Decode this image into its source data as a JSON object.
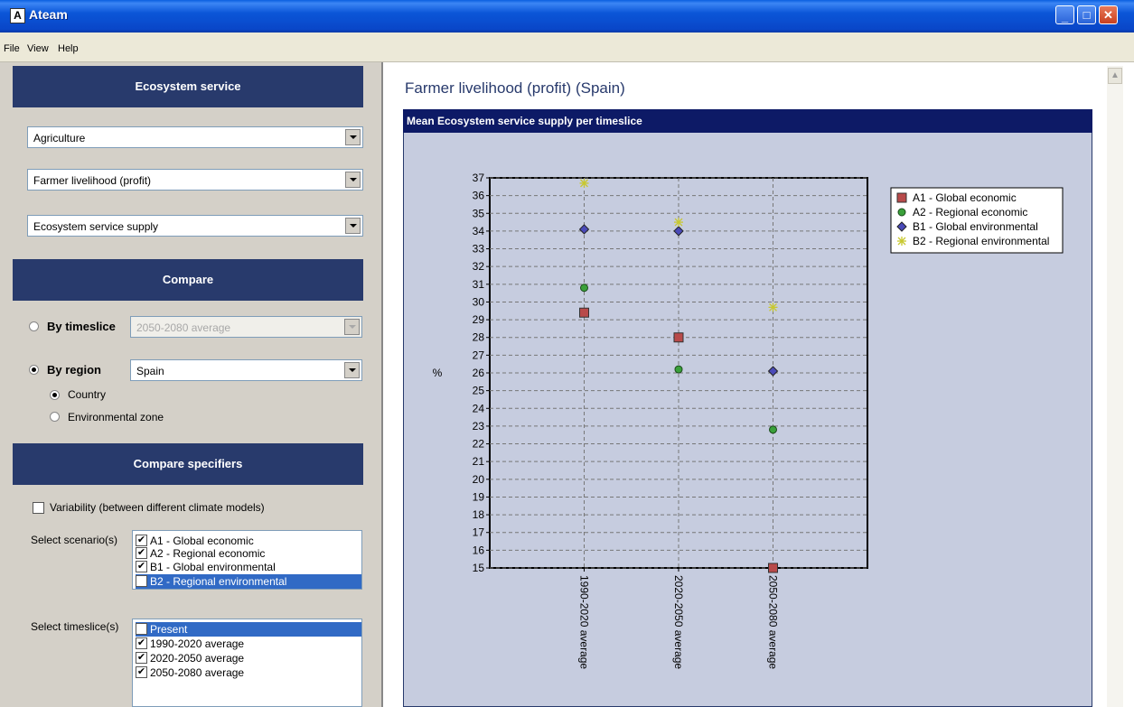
{
  "window": {
    "title": "Ateam",
    "icon_letter": "A"
  },
  "menu": [
    "File",
    "View",
    "Help"
  ],
  "ecosystem_service": {
    "header": "Ecosystem service",
    "sector": "Agriculture",
    "service": "Farmer livelihood (profit)",
    "indicator": "Ecosystem service supply"
  },
  "compare": {
    "header": "Compare",
    "by_timeslice_label": "By timeslice",
    "timeslice_value": "2050-2080 average",
    "by_region_label": "By region",
    "region_value": "Spain",
    "country_label": "Country",
    "env_zone_label": "Environmental zone",
    "selected_mode": "By region",
    "selected_region_type": "Country"
  },
  "compare_specifiers": {
    "header": "Compare specifiers",
    "variability_label": "Variability (between different climate models)",
    "variability_checked": false,
    "scenarios_label": "Select scenario(s)",
    "scenarios": [
      {
        "label": "A1 - Global economic",
        "checked": true,
        "selected": false
      },
      {
        "label": "A2 - Regional economic",
        "checked": true,
        "selected": false
      },
      {
        "label": "B1 - Global environmental",
        "checked": true,
        "selected": false
      },
      {
        "label": "B2 - Regional environmental",
        "checked": true,
        "selected": true
      }
    ],
    "timeslices_label": "Select timeslice(s)",
    "timeslices": [
      {
        "label": "Present",
        "checked": false,
        "selected": true
      },
      {
        "label": "1990-2020 average",
        "checked": true,
        "selected": false
      },
      {
        "label": "2020-2050 average",
        "checked": true,
        "selected": false
      },
      {
        "label": "2050-2080 average",
        "checked": true,
        "selected": false
      }
    ]
  },
  "main": {
    "page_title": "Farmer livelihood (profit) (Spain)",
    "chart_header": "Mean Ecosystem service supply per timeslice"
  },
  "chart_data": {
    "type": "scatter",
    "title": "",
    "ylabel": "%",
    "xlabel": "",
    "ylim": [
      15,
      37
    ],
    "yticks": [
      15,
      16,
      17,
      18,
      19,
      20,
      21,
      22,
      23,
      24,
      25,
      26,
      27,
      28,
      29,
      30,
      31,
      32,
      33,
      34,
      35,
      36,
      37
    ],
    "categories": [
      "1990-2020 average",
      "2020-2050 average",
      "2050-2080 average"
    ],
    "grid": true,
    "legend_position": "top-right",
    "series": [
      {
        "name": "A1 - Global economic",
        "marker": "square",
        "color": "#b84a4a",
        "values": [
          29.4,
          28.0,
          15.0
        ]
      },
      {
        "name": "A2 - Regional economic",
        "marker": "circle",
        "color": "#3aa03a",
        "values": [
          30.8,
          26.2,
          22.8
        ]
      },
      {
        "name": "B1 - Global environmental",
        "marker": "diamond",
        "color": "#4a4ab8",
        "values": [
          34.1,
          34.0,
          26.1
        ]
      },
      {
        "name": "B2 - Regional environmental",
        "marker": "asterisk",
        "color": "#c8c830",
        "values": [
          36.7,
          34.5,
          29.7
        ]
      }
    ]
  }
}
